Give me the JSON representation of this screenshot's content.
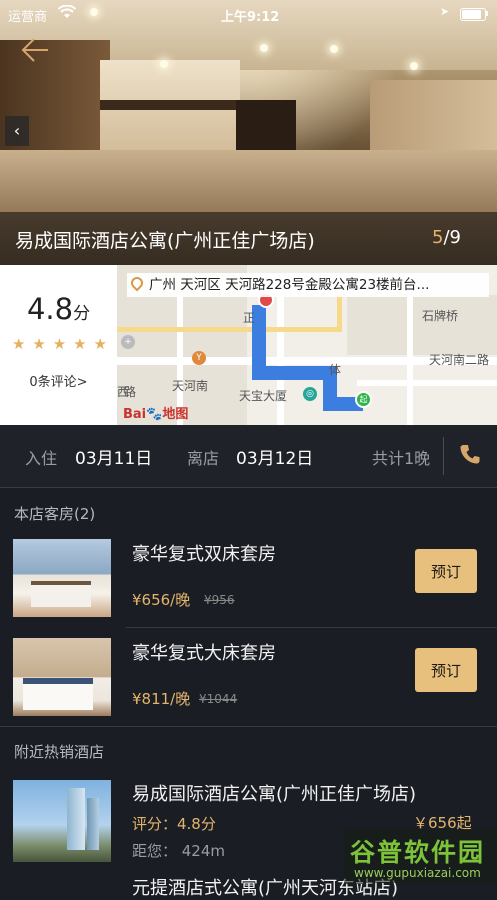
{
  "status_bar": {
    "carrier": "运营商",
    "time": "上午9:12"
  },
  "hotel_header": {
    "name": "易成国际酒店公寓(广州正佳广场店)",
    "photo_current": "5",
    "photo_total": "/9"
  },
  "rating": {
    "score": "4.8",
    "unit": "分",
    "stars": 5,
    "reviews_link": "0条评论>"
  },
  "map": {
    "address": "广州 天河区 天河路228号金殿公寓23楼前台...",
    "labels": {
      "shipaiqiao": "石牌桥",
      "tianhenan2": "天河南二路",
      "tianhenan": "天河南",
      "tianbao": "天宝大厦",
      "ti": "体",
      "xi": "西",
      "lu": "路",
      "zheng": "正"
    },
    "brand": "Bai",
    "brand2": "地图",
    "start_marker": "起"
  },
  "stay": {
    "checkin_label": "入住",
    "checkin_date": "03月11日",
    "checkout_label": "离店",
    "checkout_date": "03月12日",
    "nights": "共计1晚"
  },
  "rooms_section": {
    "title": "本店客房(2)",
    "rooms": [
      {
        "name": "豪华复式双床套房",
        "price": "¥656/晚",
        "original_price": "¥956",
        "book_label": "预订"
      },
      {
        "name": "豪华复式大床套房",
        "price": "¥811/晚",
        "original_price": "¥1044",
        "book_label": "预订"
      }
    ]
  },
  "nearby_section": {
    "title": "附近热销酒店",
    "hotels": [
      {
        "name": "易成国际酒店公寓(广州正佳广场店)",
        "score": "评分：4.8分",
        "distance": "距您：  424m",
        "price": "￥656起"
      }
    ],
    "partial_next": "元提酒店式公寓(广州天河东站店)"
  },
  "watermark": {
    "main": "谷普软件园",
    "url": "www.gupuxiazai.com"
  },
  "colors": {
    "accent": "#e3b46c",
    "background": "#1a1d23",
    "book_button": "#e8c07d"
  }
}
